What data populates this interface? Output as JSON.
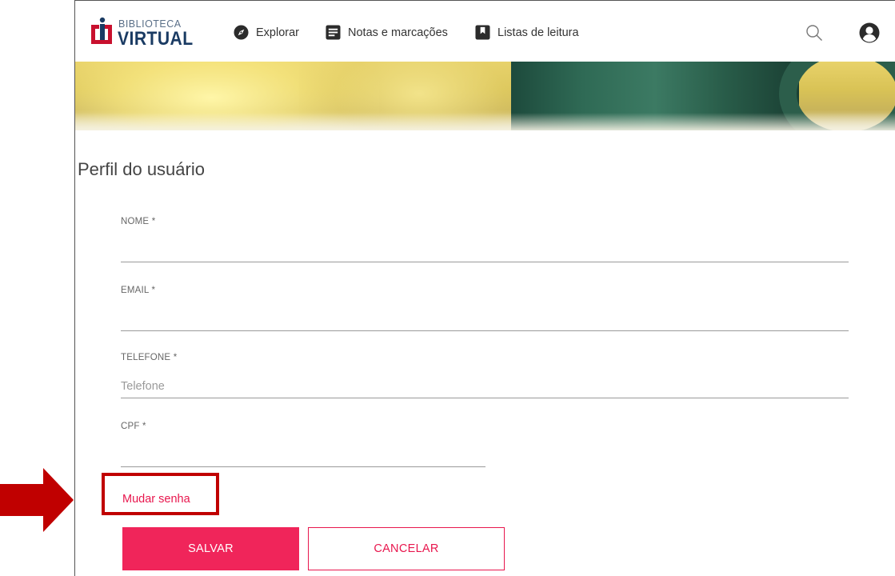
{
  "logo": {
    "line1": "BIBLIOTECA",
    "line2": "VIRTUAL"
  },
  "nav": [
    {
      "label": "Explorar",
      "icon": "compass-icon"
    },
    {
      "label": "Notas e marcações",
      "icon": "note-icon"
    },
    {
      "label": "Listas de leitura",
      "icon": "bookmark-icon"
    }
  ],
  "page_title": "Perfil do usuário",
  "form": {
    "nome": {
      "label": "NOME *",
      "value": "",
      "placeholder": ""
    },
    "email": {
      "label": "EMAIL *",
      "value": "",
      "placeholder": ""
    },
    "telefone": {
      "label": "TELEFONE *",
      "value": "",
      "placeholder": "Telefone"
    },
    "cpf": {
      "label": "CPF *",
      "value": "",
      "placeholder": ""
    }
  },
  "change_password_label": "Mudar senha",
  "buttons": {
    "save": "SALVAR",
    "cancel": "CANCELAR"
  },
  "colors": {
    "accent": "#f0255a",
    "highlight_box": "#c00000",
    "logo_blue": "#1a3b63"
  }
}
